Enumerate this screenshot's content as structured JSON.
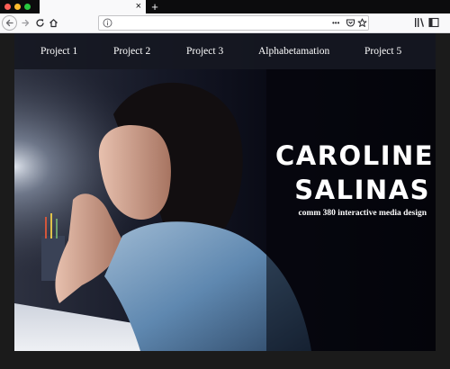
{
  "browser": {
    "tab_close_glyph": "×",
    "new_tab_glyph": "+",
    "url_more_glyph": "•••",
    "icons": {
      "back": "back-arrow-icon",
      "forward": "forward-arrow-icon",
      "reload": "reload-icon",
      "home": "home-icon",
      "info": "info-icon",
      "pocket": "pocket-icon",
      "star": "bookmark-star-icon",
      "library": "library-icon",
      "sidebar": "sidebar-icon"
    },
    "traffic_lights": [
      "#fe5f57",
      "#febc2e",
      "#28c840"
    ]
  },
  "site": {
    "nav": [
      "Project 1",
      "Project 2",
      "Project 3",
      "Alphabetamation",
      "Project 5"
    ],
    "hero": {
      "name_line1": "CAROLINE",
      "name_line2": "SALINAS",
      "subtitle": "comm 380 interactive media design"
    },
    "colors": {
      "nav_bg": "#161822",
      "page_bg": "#070810",
      "shirt": "#5f88b0",
      "text": "#ffffff"
    }
  }
}
